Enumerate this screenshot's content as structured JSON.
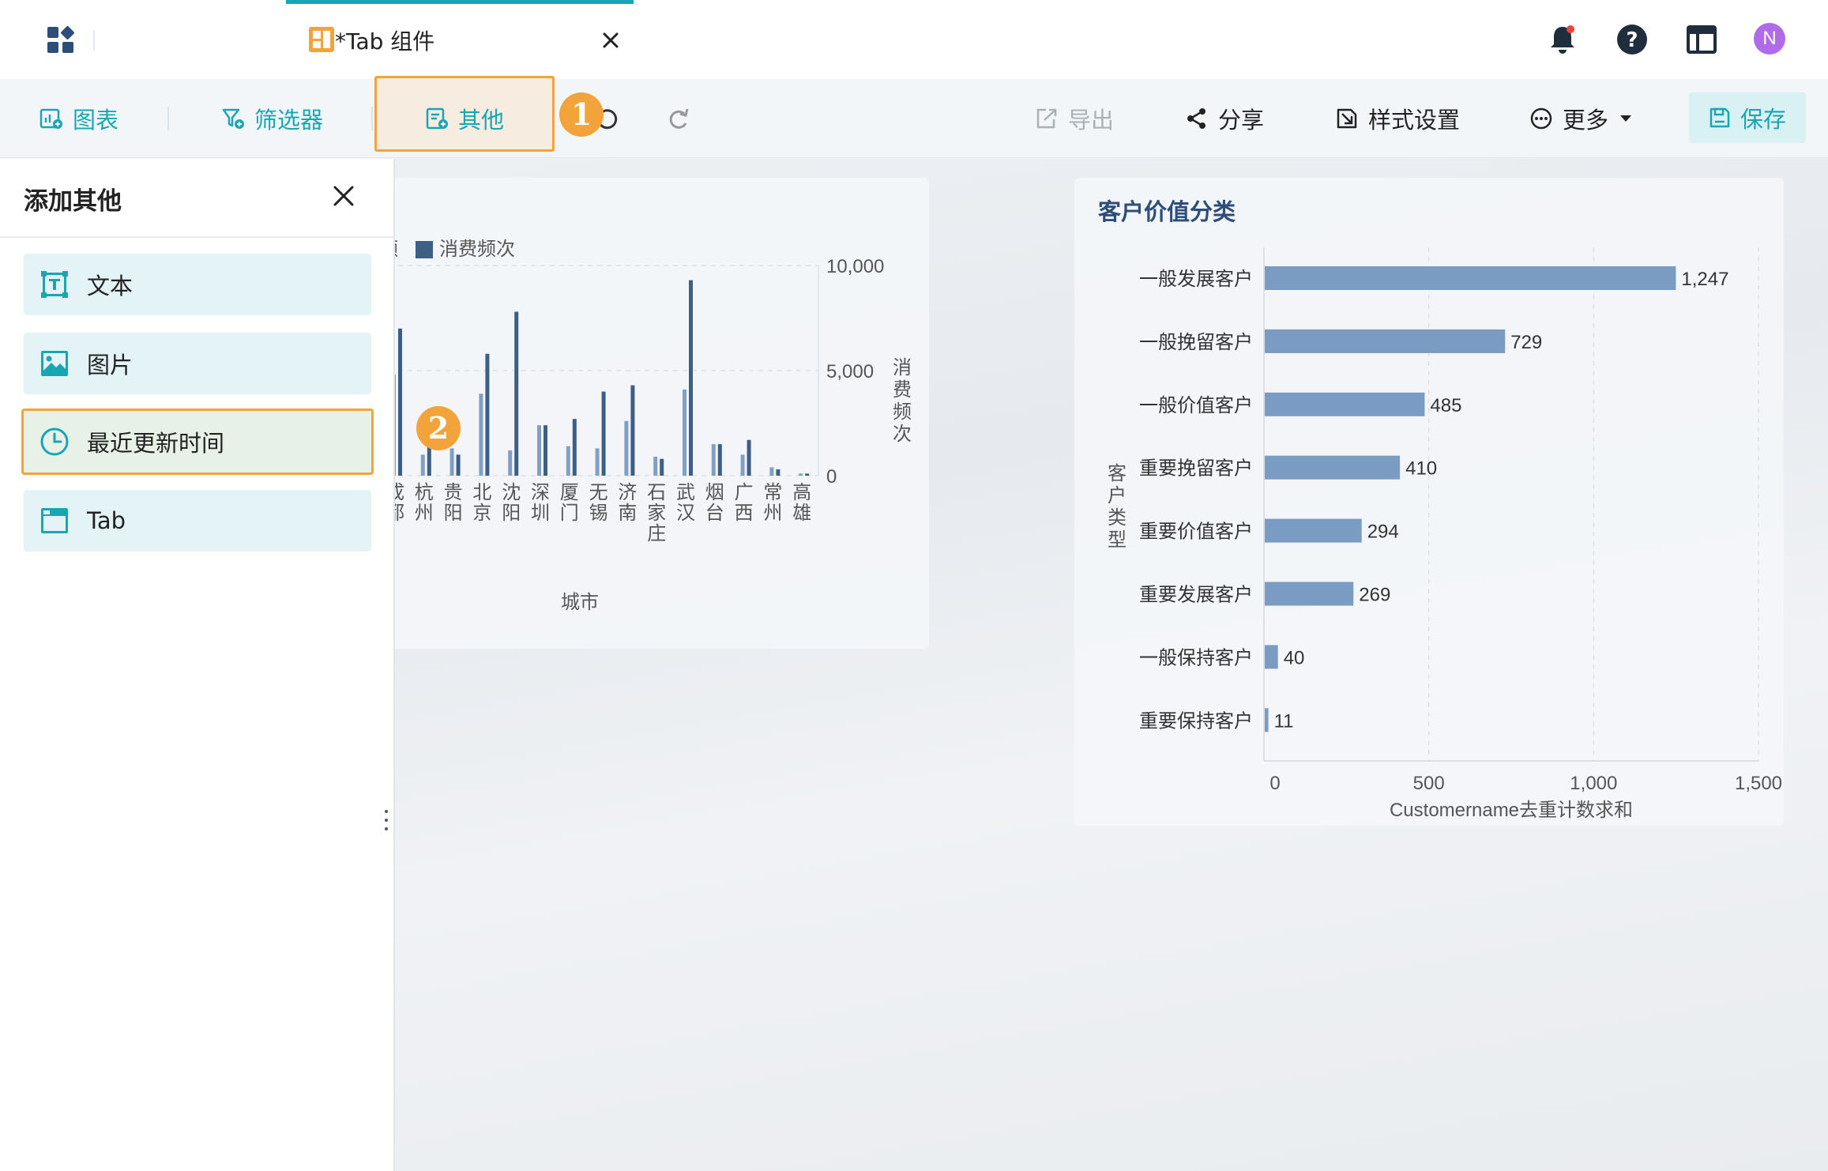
{
  "header": {
    "tab_title": "*Tab 组件",
    "avatar_letter": "N"
  },
  "toolbar": {
    "chart_label": "图表",
    "filter_label": "筛选器",
    "other_label": "其他",
    "export_label": "导出",
    "share_label": "分享",
    "style_label": "样式设置",
    "more_label": "更多",
    "save_label": "保存",
    "step1": "1",
    "step2": "2"
  },
  "panel": {
    "title": "添加其他",
    "items": [
      {
        "label": "文本",
        "icon": "text-icon"
      },
      {
        "label": "图片",
        "icon": "image-icon"
      },
      {
        "label": "最近更新时间",
        "icon": "clock-icon"
      },
      {
        "label": "Tab",
        "icon": "tab-icon"
      }
    ]
  },
  "colors": {
    "accent": "#19a6b3",
    "highlight": "#f2a33a",
    "bar_left": "#3d5f86",
    "bar_light": "#7f9fc4",
    "bar_right": "#7a9cc2"
  },
  "chart_data": [
    {
      "type": "bar",
      "title": "",
      "legend": [
        "消费频次"
      ],
      "legend_partial_prefix": "额",
      "xlabel": "城市",
      "ylabel": "消费频次",
      "yticks": [
        "10,000",
        "5,000",
        "0"
      ],
      "ylim": [
        0,
        10000
      ],
      "categories": [
        "成都",
        "杭州",
        "贵阳",
        "北京",
        "沈阳",
        "深圳",
        "厦门",
        "无锡",
        "济南",
        "石家庄",
        "武汉",
        "烟台",
        "广西",
        "常州",
        "高雄"
      ],
      "values": [
        7000,
        1800,
        1000,
        5800,
        7800,
        2400,
        2700,
        4000,
        4300,
        800,
        9300,
        1500,
        1700,
        300,
        100
      ],
      "secondary_values": [
        4800,
        1000,
        1300,
        3900,
        1200,
        2400,
        1400,
        1300,
        2600,
        900,
        4100,
        1500,
        1000,
        400,
        100
      ]
    },
    {
      "type": "bar",
      "orientation": "horizontal",
      "title": "客户价值分类",
      "xlabel": "Customername去重计数求和",
      "ylabel": "客户类型",
      "xticks": [
        "0",
        "500",
        "1,000",
        "1,500"
      ],
      "xlim": [
        0,
        1500
      ],
      "categories": [
        "一般发展客户",
        "一般挽留客户",
        "一般价值客户",
        "重要挽留客户",
        "重要价值客户",
        "重要发展客户",
        "一般保持客户",
        "重要保持客户"
      ],
      "values": [
        1247,
        729,
        485,
        410,
        294,
        269,
        40,
        11
      ],
      "value_labels": [
        "1,247",
        "729",
        "485",
        "410",
        "294",
        "269",
        "40",
        "11"
      ]
    }
  ]
}
